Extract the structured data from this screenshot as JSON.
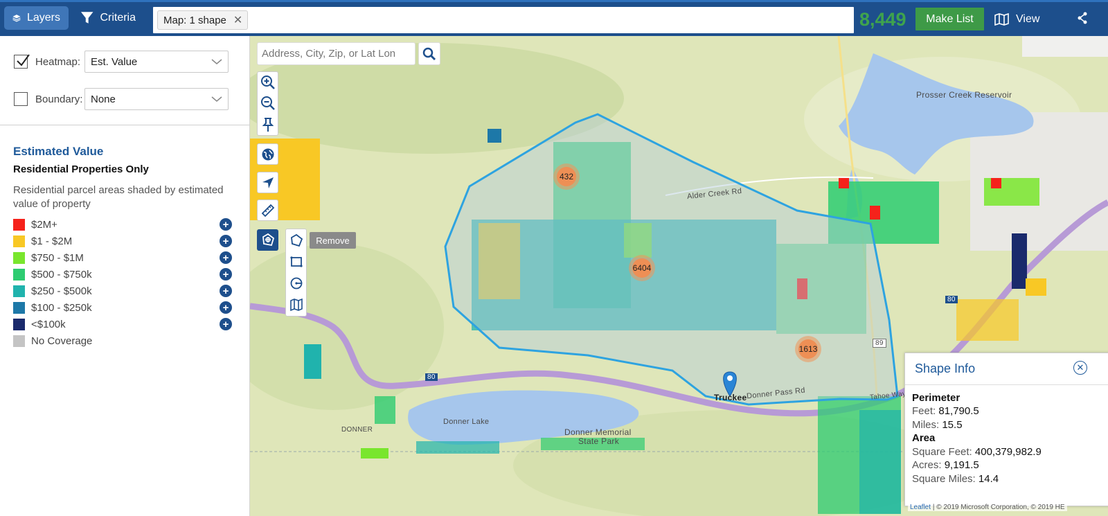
{
  "topbar": {
    "layers_label": "Layers",
    "criteria_label": "Criteria",
    "filter_chip": "Map: 1 shape",
    "chip_close": "✕",
    "result_count": "8,449",
    "make_list_label": "Make List",
    "view_label": "View"
  },
  "sidebar": {
    "heatmap_label": "Heatmap:",
    "heatmap_checked": true,
    "heatmap_value": "Est. Value",
    "boundary_label": "Boundary:",
    "boundary_checked": false,
    "boundary_value": "None",
    "legend_title": "Estimated Value",
    "legend_subtitle": "Residential Properties Only",
    "legend_description": "Residential parcel areas shaded by estimated value of property",
    "legend_items": [
      {
        "label": "$2M+",
        "color": "#f5221b"
      },
      {
        "label": "$1 - $2M",
        "color": "#f8c825"
      },
      {
        "label": "$750 - $1M",
        "color": "#79e62d"
      },
      {
        "label": "$500 - $750k",
        "color": "#2ecc71"
      },
      {
        "label": "$250 - $500k",
        "color": "#20b3ad"
      },
      {
        "label": "$100 - $250k",
        "color": "#1d78a8"
      },
      {
        "label": "<$100k",
        "color": "#1a2a6c"
      },
      {
        "label": "No Coverage",
        "color": "#c4c4c4"
      }
    ]
  },
  "map": {
    "search_placeholder": "Address, City, Zip, or Lat Lon",
    "remove_tooltip": "Remove",
    "clusters": [
      "432",
      "6404",
      "1613"
    ],
    "labels": {
      "reservoir": "Prosser Creek Reservoir",
      "alder_creek": "Alder Creek Rd",
      "donner_lake": "Donner Lake",
      "donner_park_1": "Donner Memorial",
      "donner_park_2": "State Park",
      "truckee": "Truckee",
      "donner_pass": "Donner Pass Rd",
      "hwy_80a": "80",
      "hwy_80b": "80",
      "hwy_89": "89",
      "donner_town": "DONNER",
      "tahoe_way": "Tahoe Way"
    },
    "shape_info": {
      "title": "Shape Info",
      "close": "✕",
      "perimeter_head": "Perimeter",
      "feet_label": "Feet:",
      "feet_value": "81,790.5",
      "miles_label": "Miles:",
      "miles_value": "15.5",
      "area_head": "Area",
      "sqft_label": "Square Feet:",
      "sqft_value": "400,379,982.9",
      "acres_label": "Acres:",
      "acres_value": "9,191.5",
      "sqmi_label": "Square Miles:",
      "sqmi_value": "14.4"
    },
    "attribution_link": "Leaflet",
    "attribution_text": "| © 2019 Microsoft Corporation, © 2019 HE"
  }
}
